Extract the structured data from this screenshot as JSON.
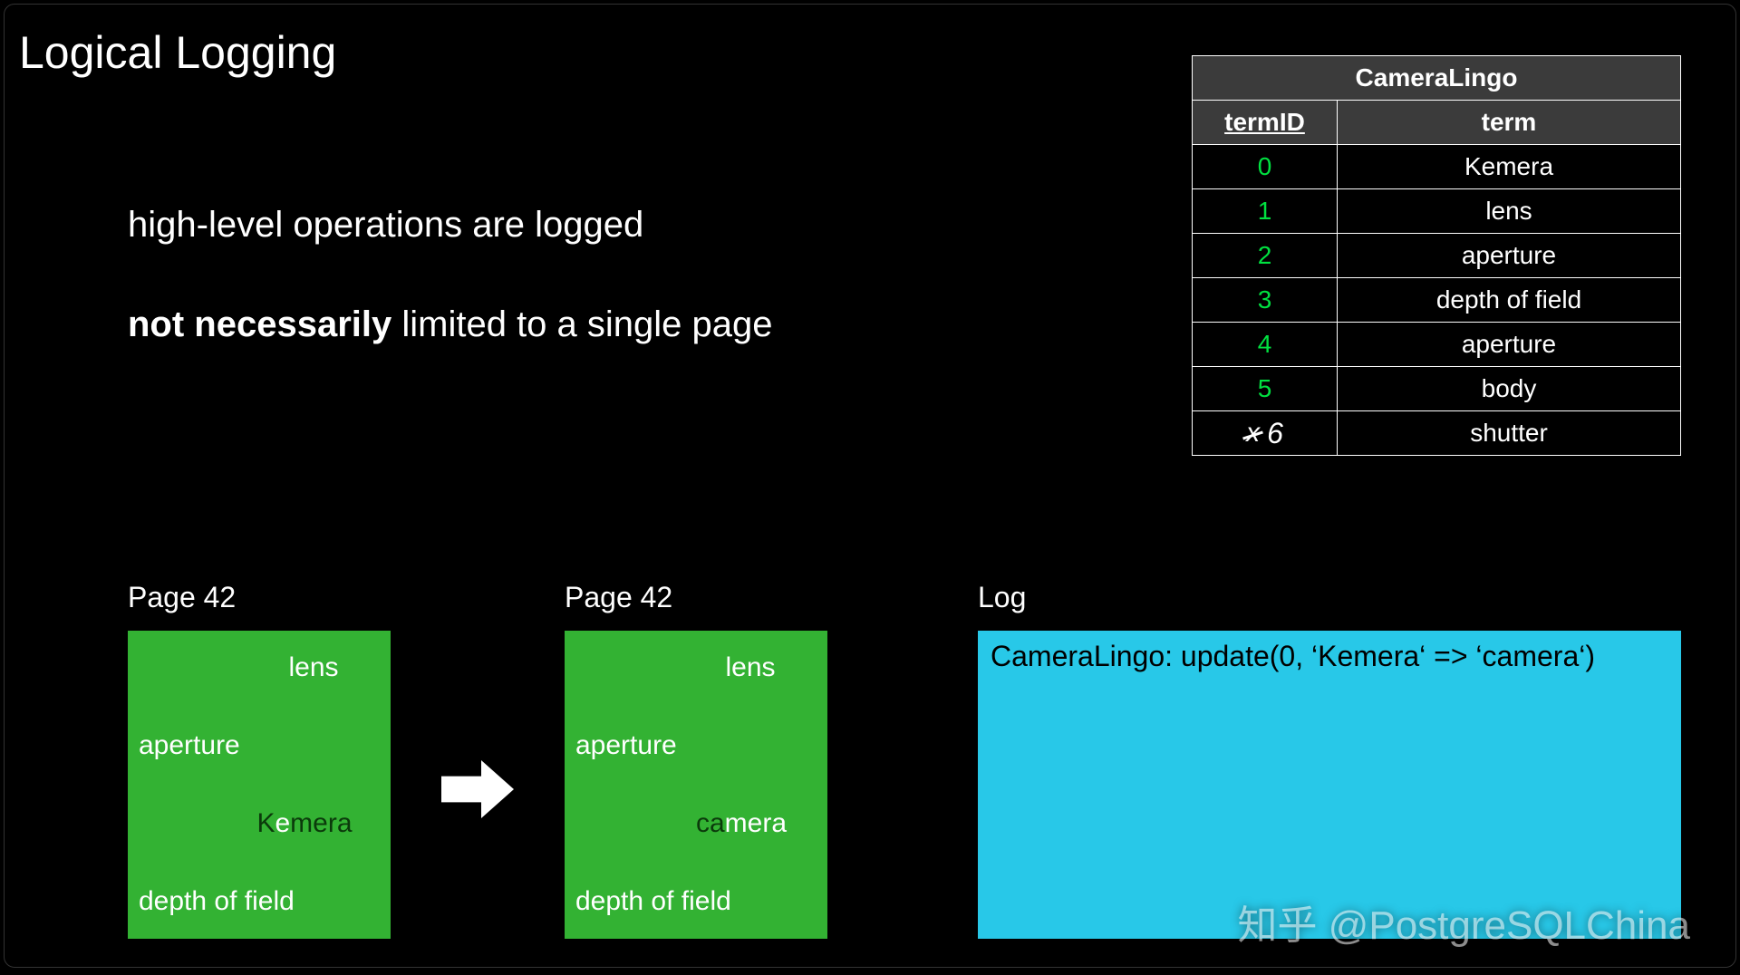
{
  "title": "Logical Logging",
  "description": {
    "line1": "high-level operations are logged",
    "line2_bold": "not necessarily",
    "line2_rest": " limited to a single page"
  },
  "table": {
    "title": "CameraLingo",
    "columns": [
      "termID",
      "term"
    ],
    "rows": [
      {
        "id": "0",
        "term": "Kemera"
      },
      {
        "id": "1",
        "term": "lens"
      },
      {
        "id": "2",
        "term": "aperture"
      },
      {
        "id": "3",
        "term": "depth of field"
      },
      {
        "id": "4",
        "term": "aperture"
      },
      {
        "id": "5",
        "term": "body"
      },
      {
        "id_struck": "x",
        "id_new": "6",
        "term": "shutter"
      }
    ]
  },
  "page_left": {
    "label": "Page 42",
    "items": {
      "lens": "lens",
      "aperture": "aperture",
      "keyword_dark": "K",
      "keyword_light": "e",
      "keyword_dark2": "mera",
      "depth": "depth of field"
    }
  },
  "page_right": {
    "label": "Page 42",
    "items": {
      "lens": "lens",
      "aperture": "aperture",
      "keyword_dark": "ca",
      "keyword_light": "mera",
      "depth": "depth of field"
    }
  },
  "log": {
    "label": "Log",
    "entry": "CameraLingo: update(0, ‘Kemera‘ => ‘camera‘)"
  },
  "watermark": "知乎 @PostgreSQLChina"
}
